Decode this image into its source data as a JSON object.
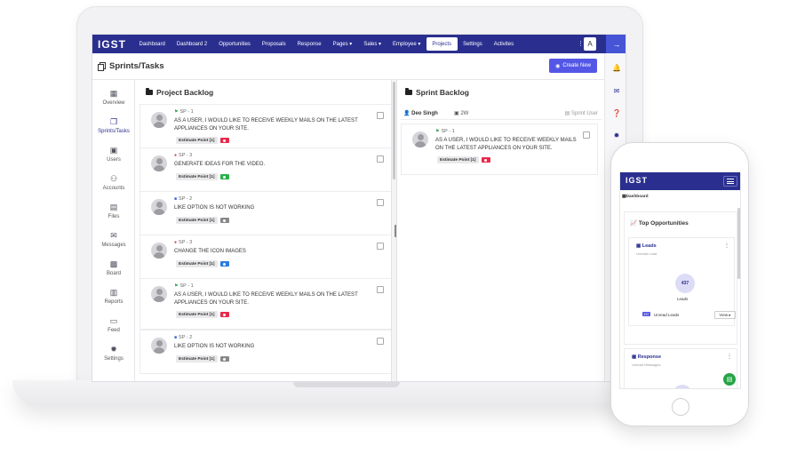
{
  "app": {
    "logo": "IGST",
    "nav": [
      "Dashboard",
      "Dashboard 2",
      "Opportunities",
      "Proposals",
      "Response",
      "Pages ▾",
      "Sales ▾",
      "Employee ▾",
      "Projects",
      "Settings",
      "Activites"
    ],
    "active_nav": "Projects",
    "avatar_letter": "A"
  },
  "page": {
    "title": "Sprints/Tasks",
    "create_label": "Create New"
  },
  "sidebar": {
    "items": [
      {
        "label": "Overview",
        "icon": "grid-icon"
      },
      {
        "label": "Sprints/Tasks",
        "icon": "copy-icon",
        "active": true
      },
      {
        "label": "Users",
        "icon": "user-icon"
      },
      {
        "label": "Accounts",
        "icon": "accounts-icon"
      },
      {
        "label": "Files",
        "icon": "file-icon"
      },
      {
        "label": "Messages",
        "icon": "mail-icon"
      },
      {
        "label": "Board",
        "icon": "board-icon"
      },
      {
        "label": "Reports",
        "icon": "chart-icon"
      },
      {
        "label": "Feed",
        "icon": "feed-icon"
      },
      {
        "label": "Settings",
        "icon": "gear-icon"
      }
    ]
  },
  "backlog": {
    "title": "Project Backlog",
    "cards": [
      {
        "sp": "SP - 1",
        "mark_color": "#2e9e4a",
        "text": "AS A USER, I WOULD LIKE TO RECEIVE WEEKLY MAILS ON THE LATEST APPLIANCES ON YOUR SITE.",
        "estimate": "Estimate Point [1]",
        "chip": "#e8294b"
      },
      {
        "sp": "SP - 3",
        "mark_color": "#e8294b",
        "text": "GENERATE IDEAS FOR THE VIDEO.",
        "estimate": "Estimate Point [1]",
        "chip": "#27b24a"
      },
      {
        "sp": "SP - 2",
        "mark_color": "#3a5bd6",
        "text": "LIKE OPTION IS NOT WORKING",
        "estimate": "Estimate Point [1]",
        "chip": "#888888"
      },
      {
        "sp": "SP - 3",
        "mark_color": "#e8294b",
        "text": "CHANGE THE ICON IMAGES",
        "estimate": "Estimate Point [1]",
        "chip": "#2a7be0"
      },
      {
        "sp": "SP - 1",
        "mark_color": "#2e9e4a",
        "text": "AS A USER, I WOULD LIKE TO RECEIVE WEEKLY MAILS ON THE LATEST APPLIANCES ON YOUR SITE.",
        "estimate": "Estimate Point [1]",
        "chip": "#e8294b"
      },
      {
        "sp": "SP - 2",
        "mark_color": "#3a5bd6",
        "text": "LIKE OPTION IS NOT WORKING",
        "estimate": "Estimate Point [1]",
        "chip": "#888888"
      }
    ]
  },
  "sprint": {
    "title": "Sprint Backlog",
    "user": "Deo Singh",
    "duration": "2W",
    "sprint_user": "Sprint User",
    "card": {
      "sp": "SP - 1",
      "mark_color": "#2e9e4a",
      "text": "AS A USER, I WOULD LIKE TO RECEIVE WEEKLY MAILS ON THE LATEST APPLIANCES ON YOUR SITE.",
      "estimate": "Estimate Point [1]",
      "chip": "#e8294b"
    }
  },
  "phone": {
    "logo": "IGST",
    "crumb": "Dashboard",
    "top_title": "Top Opportunities",
    "leads_title": "Leads",
    "leads_sub": "Unread Lead",
    "leads_count": "437",
    "leads_label": "Leads",
    "unread_badge": "437",
    "unread_label": "Unread Leads",
    "view_label": "View ▸",
    "response_title": "Response",
    "response_sub": "Unread Messages"
  }
}
